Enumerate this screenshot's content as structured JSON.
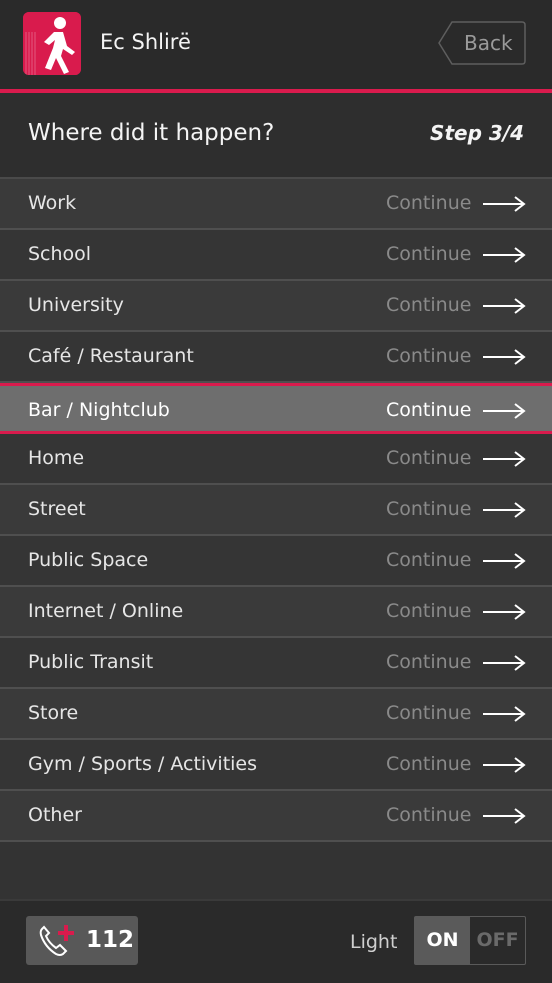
{
  "header": {
    "app_title": "Ec Shlirë",
    "back_label": "Back"
  },
  "question": {
    "text": "Where did it happen?",
    "step": "Step 3/4"
  },
  "options": [
    {
      "label": "Work",
      "cta": "Continue",
      "selected": false
    },
    {
      "label": "School",
      "cta": "Continue",
      "selected": false
    },
    {
      "label": "University",
      "cta": "Continue",
      "selected": false
    },
    {
      "label": "Café / Restaurant",
      "cta": "Continue",
      "selected": false
    },
    {
      "label": "Bar / Nightclub",
      "cta": "Continue",
      "selected": true
    },
    {
      "label": "Home",
      "cta": "Continue",
      "selected": false
    },
    {
      "label": "Street",
      "cta": "Continue",
      "selected": false
    },
    {
      "label": "Public Space",
      "cta": "Continue",
      "selected": false
    },
    {
      "label": "Internet / Online",
      "cta": "Continue",
      "selected": false
    },
    {
      "label": "Public Transit",
      "cta": "Continue",
      "selected": false
    },
    {
      "label": "Store",
      "cta": "Continue",
      "selected": false
    },
    {
      "label": "Gym / Sports / Activities",
      "cta": "Continue",
      "selected": false
    },
    {
      "label": "Other",
      "cta": "Continue",
      "selected": false
    }
  ],
  "footer": {
    "emergency_number": "112",
    "light_label": "Light",
    "toggle_on": "ON",
    "toggle_off": "OFF",
    "light_state": "on"
  },
  "colors": {
    "accent": "#d91b4d",
    "background": "#2e2e2e",
    "selected_row": "#6e6e6e"
  },
  "icons": {
    "logo": "walking-person-icon",
    "row_arrow": "arrow-right-icon",
    "emergency": "phone-emergency-icon"
  }
}
